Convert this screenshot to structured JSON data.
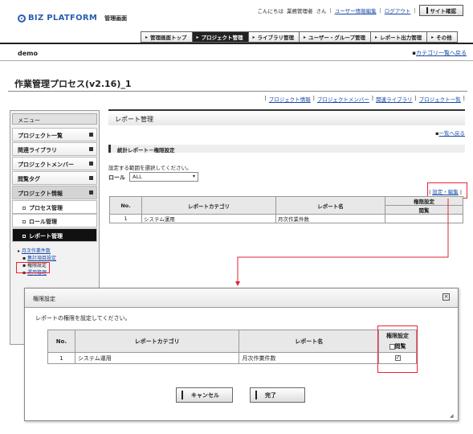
{
  "header": {
    "brand": "BIZ PLATFORM",
    "subtitle": "管理画面",
    "greeting": "こんにちは",
    "user": "業務管理者",
    "honorific": "さん",
    "user_edit": "ユーザー情報編集",
    "logout": "ログアウト",
    "site_confirm": "サイト確認"
  },
  "nav": {
    "tabs": [
      "管理画面トップ",
      "プロジェクト管理",
      "ライブラリ管理",
      "ユーザー・グループ管理",
      "レポート出力管理",
      "その他"
    ],
    "active_index": 1
  },
  "org": "demo",
  "category_back": "カテゴリ一覧へ戻る",
  "page_title": "作業管理プロセス(v2.16)_1",
  "sublinks": [
    "プロジェクト情報",
    "プロジェクトメンバー",
    "関連ライブラリ",
    "プロジェクト一覧"
  ],
  "sidebar": {
    "menu": "メニュー",
    "items": [
      "プロジェクト一覧",
      "関連ライブラリ",
      "プロジェクトメンバー",
      "閲覧タグ",
      "プロジェクト情報"
    ],
    "subitems": [
      "プロセス管理",
      "ロール管理",
      "レポート管理"
    ],
    "tree": [
      "月次作業件数",
      "集計項目設定",
      "権限設定",
      "運用管理"
    ]
  },
  "main": {
    "section_title": "レポート管理",
    "back_link": "一覧へ戻る",
    "stat_title": "統計レポート－権限設定",
    "scope_text": "設定する範囲を選択してください。",
    "role_label": "ロール",
    "role_value": "ALL",
    "edit_link": "設定・編集",
    "table": {
      "headers": [
        "No.",
        "レポートカテゴリ",
        "レポート名",
        "権限設定",
        "閲覧"
      ],
      "rows": [
        [
          "1",
          "システム運用",
          "月次作業件数"
        ]
      ]
    }
  },
  "dialog": {
    "title": "権限設定",
    "message": "レポートの権限を設定してください。",
    "headers": [
      "No.",
      "レポートカテゴリ",
      "レポート名",
      "権限設定",
      "閲覧"
    ],
    "rows": [
      [
        "1",
        "システム運用",
        "月次作業件数"
      ]
    ],
    "cancel": "キャンセル",
    "ok": "完了"
  },
  "colors": {
    "highlight": "#e22233",
    "brand": "#2a5db0"
  }
}
